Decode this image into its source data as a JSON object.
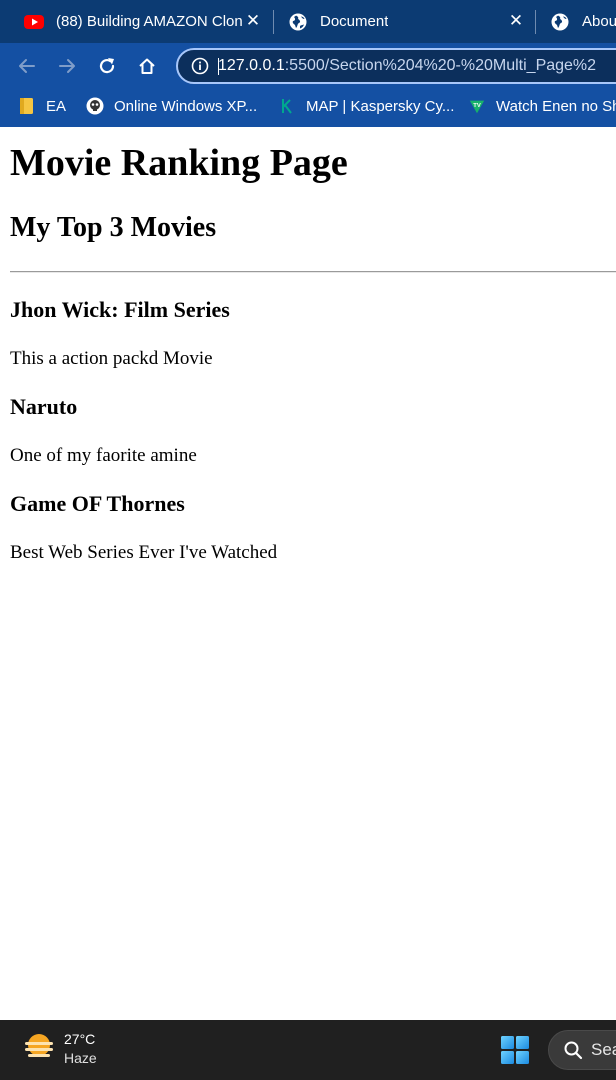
{
  "browser": {
    "tabs": [
      {
        "title": "(88) Building AMAZON Clon",
        "favicon": "youtube-icon"
      },
      {
        "title": "Document",
        "favicon": "globe-icon"
      },
      {
        "title": "Abou",
        "favicon": "globe-icon"
      }
    ],
    "close_glyph": "✕",
    "url_host": "127.0.0.1",
    "url_rest": ":5500/Section%204%20-%20Multi_Page%2",
    "bookmarks": [
      {
        "label": "EA",
        "icon": "folder-icon"
      },
      {
        "label": "Online Windows XP...",
        "icon": "skull-icon"
      },
      {
        "label": "MAP | Kaspersky Cy...",
        "icon": "kaspersky-icon"
      },
      {
        "label": "Watch Enen no Sh",
        "icon": "tv-icon"
      }
    ],
    "colors": {
      "tabstrip": "#0c3b73",
      "toolbar": "#1450a3",
      "omnibox": "#0c2f5c"
    }
  },
  "page": {
    "title": "Movie Ranking Page",
    "subtitle": "My Top 3 Movies",
    "movies": [
      {
        "name": "Jhon Wick: Film Series",
        "description": "This a action packd Movie"
      },
      {
        "name": "Naruto",
        "description": "One of my faorite amine"
      },
      {
        "name": "Game OF Thornes",
        "description": "Best Web Series Ever I've Watched"
      }
    ]
  },
  "taskbar": {
    "temperature": "27°C",
    "condition": "Haze",
    "search_label": "Sea"
  }
}
